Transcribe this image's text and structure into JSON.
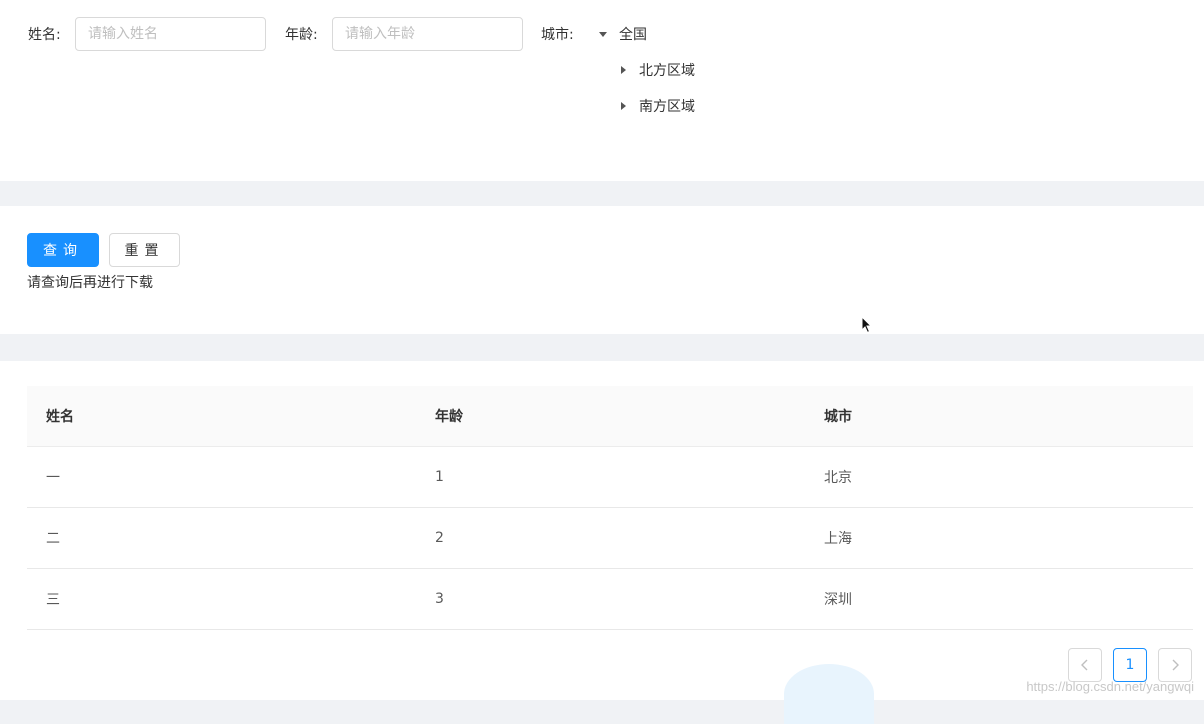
{
  "filter": {
    "name_label": "姓名:",
    "name_placeholder": "请输入姓名",
    "age_label": "年龄:",
    "age_placeholder": "请输入年龄",
    "city_label": "城市:",
    "city_tree": {
      "root": "全国",
      "children": [
        "北方区域",
        "南方区域"
      ]
    }
  },
  "actions": {
    "search_label": "查询",
    "reset_label": "重置",
    "hint": "请查询后再进行下载"
  },
  "table": {
    "columns": [
      "姓名",
      "年龄",
      "城市"
    ],
    "rows": [
      [
        "一",
        "1",
        "北京"
      ],
      [
        "二",
        "2",
        "上海"
      ],
      [
        "三",
        "3",
        "深圳"
      ]
    ]
  },
  "pagination": {
    "current_page": "1",
    "prev_icon": "chevron-left-icon",
    "next_icon": "chevron-right-icon"
  },
  "watermark": "https://blog.csdn.net/yangwqi",
  "colors": {
    "primary": "#1890ff",
    "border": "#d9d9d9",
    "page_bg": "#f0f2f5"
  }
}
